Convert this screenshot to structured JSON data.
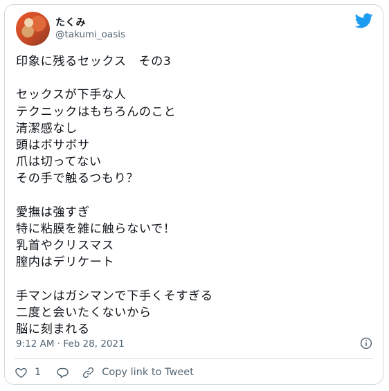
{
  "tweet": {
    "author_name": "たくみ",
    "handle": "@takumi_oasis",
    "text": "印象に残るセックス　その3\n\nセックスが下手な人\nテクニックはもちろんのこと\n清潔感なし\n頭はボサボサ\n爪は切ってない\nその手で触るつもり？\n\n愛撫は強すぎ\n特に粘膜を雑に触らないで！\n乳首やクリスマス\n膣内はデリケート\n\n手マンはガシマンで下手くそすぎる\n二度と会いたくないから\n脳に刻まれる",
    "timestamp": "9:12 AM · Feb 28, 2021",
    "likes": "1",
    "copy_link_label": "Copy link to Tweet"
  },
  "icons": {
    "brand": "twitter-bird-icon",
    "info": "info-icon",
    "like": "heart-icon",
    "reply": "reply-bubble-icon",
    "copy": "link-icon"
  },
  "colors": {
    "brand": "#1d9bf0",
    "muted": "#536471",
    "border": "#cfd9de"
  }
}
